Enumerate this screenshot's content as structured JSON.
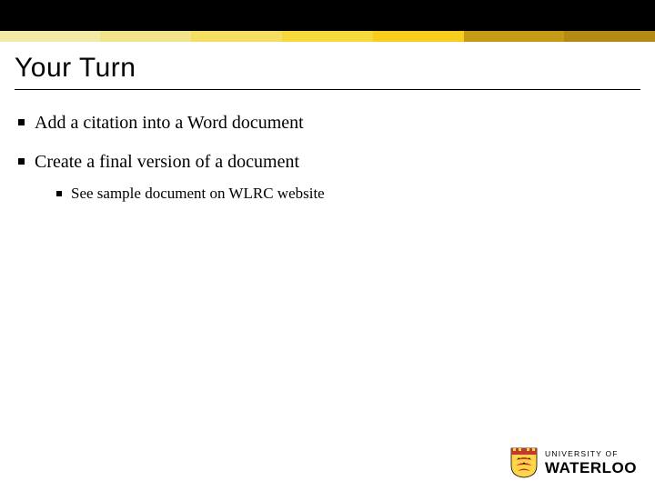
{
  "header": {
    "stripeColors": [
      "#f3eaa7",
      "#f2e48a",
      "#f4df63",
      "#f6d93a",
      "#f8ce1e",
      "#c59a17",
      "#b38a14"
    ],
    "stripeWidths": [
      110,
      100,
      100,
      100,
      100,
      110,
      100
    ]
  },
  "title": "Your Turn",
  "bullets": [
    {
      "text": "Add a citation into a Word document",
      "children": []
    },
    {
      "text": "Create a final version of a document",
      "children": [
        {
          "text": "See sample document on WLRC website"
        }
      ]
    }
  ],
  "footer": {
    "university_of": "UNIVERSITY OF",
    "name": "WATERLOO"
  }
}
